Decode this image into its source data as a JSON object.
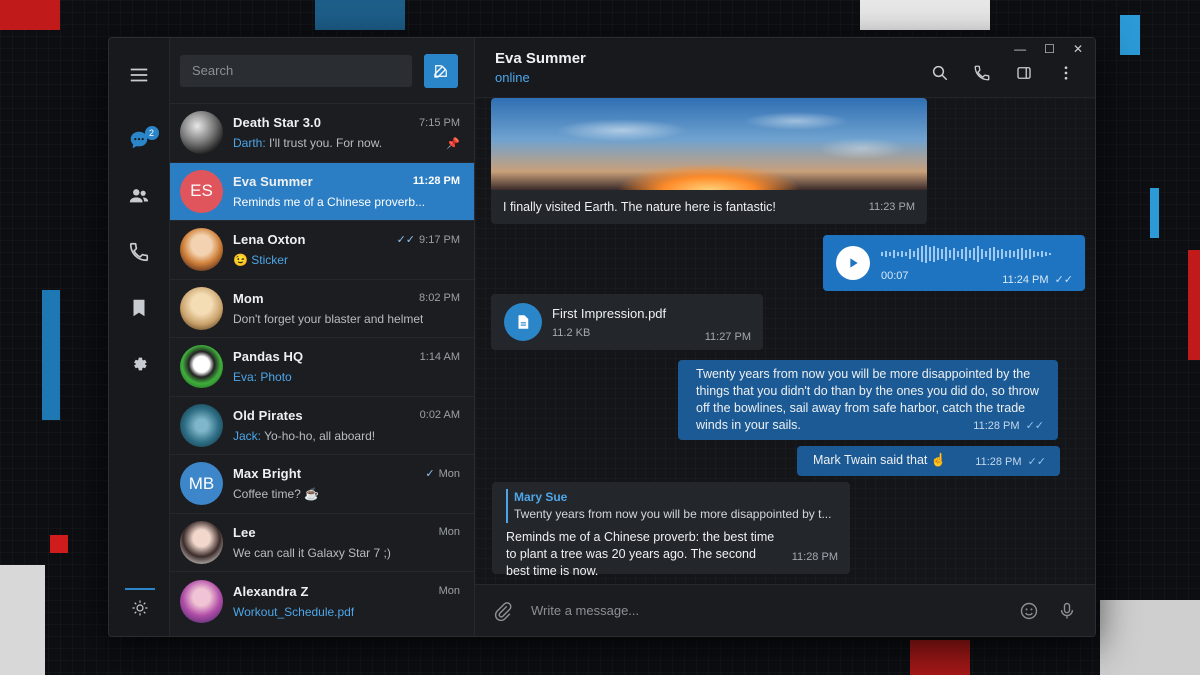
{
  "sidebar": {
    "unread_badge": "2"
  },
  "search": {
    "placeholder": "Search"
  },
  "chats": [
    {
      "name": "Death Star 3.0",
      "time": "7:15 PM",
      "sender": "Darth:",
      "preview": "I'll trust you. For now.",
      "pinned": true
    },
    {
      "name": "Eva Summer",
      "initials": "ES",
      "time": "11:28 PM",
      "preview": "Reminds me of a Chinese proverb..."
    },
    {
      "name": "Lena Oxton",
      "time": "9:17 PM",
      "preview": "😉 Sticker"
    },
    {
      "name": "Mom",
      "time": "8:02 PM",
      "preview": "Don't forget your blaster and helmet"
    },
    {
      "name": "Pandas HQ",
      "time": "1:14 AM",
      "preview": "Eva: Photo"
    },
    {
      "name": "Old Pirates",
      "time": "0:02 AM",
      "sender": "Jack:",
      "preview": "Yo-ho-ho, all aboard!"
    },
    {
      "name": "Max Bright",
      "initials": "MB",
      "time": "Mon",
      "preview": "Coffee time? ☕"
    },
    {
      "name": "Lee",
      "time": "Mon",
      "preview": "We can call it Galaxy Star 7 ;)"
    },
    {
      "name": "Alexandra Z",
      "time": "Mon",
      "preview": "Workout_Schedule.pdf"
    }
  ],
  "peer": {
    "name": "Eva Summer",
    "status": "online"
  },
  "messages": {
    "photo_caption": "I finally visited Earth. The nature here is fantastic!",
    "photo_time": "11:23 PM",
    "voice_duration": "00:07",
    "voice_time": "11:24 PM",
    "file_name": "First Impression.pdf",
    "file_size": "11.2 KB",
    "file_time": "11:27 PM",
    "quote_text": "Twenty years from now you will be more disappointed by the things that you didn't do than by the ones you did do, so throw off the bowlines, sail away from safe harbor, catch the trade winds in your sails.",
    "quote_time": "11:28 PM",
    "twain_text": "Mark Twain said that ☝",
    "twain_time": "11:28 PM",
    "reply_author": "Mary Sue",
    "reply_snippet": "Twenty years from now you will be more disappointed by t...",
    "reply_text": "Reminds me of a Chinese proverb: the best time to plant a tree was 20 years ago. The second best time is now.",
    "reply_time": "11:28 PM"
  },
  "composer": {
    "placeholder": "Write a message..."
  },
  "colors": {
    "accent": "#2b86c9",
    "outgoing": "#1b5a94",
    "incoming": "#23262b"
  }
}
